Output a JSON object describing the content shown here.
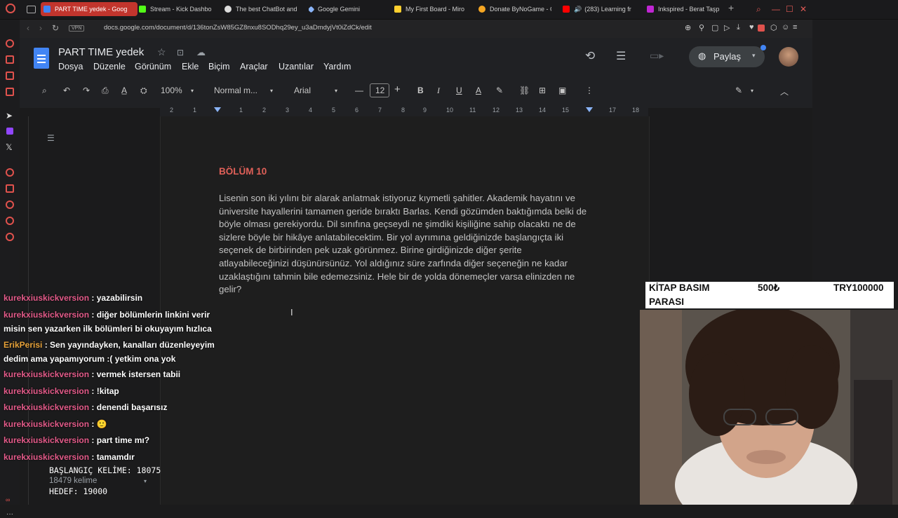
{
  "tabs": [
    {
      "label": "PART TIME yedek - Goog",
      "active": true
    },
    {
      "label": "Stream - Kick Dashbo"
    },
    {
      "label": "The best ChatBot and"
    },
    {
      "label": "Google Gemini"
    },
    {
      "label": "My First Board - Miro"
    },
    {
      "label": "Donate ByNoGame - C"
    },
    {
      "label": "(283) Learning fr"
    },
    {
      "label": "Inkspired - Berat Taşp"
    }
  ],
  "address": {
    "vpn": "VPN",
    "url": "docs.google.com/document/d/136tonZsW85GZ8nxu8SODhq29ey_u3aDmdyjVt0iZdCk/edit"
  },
  "docs": {
    "title": "PART TIME  yedek",
    "menu": [
      "Dosya",
      "Düzenle",
      "Görünüm",
      "Ekle",
      "Biçim",
      "Araçlar",
      "Uzantılar",
      "Yardım"
    ],
    "share_label": "Paylaş",
    "toolbar": {
      "zoom": "100%",
      "style": "Normal m...",
      "font": "Arial",
      "font_size": "12"
    },
    "ruler": [
      "2",
      "1",
      "1",
      "2",
      "3",
      "4",
      "5",
      "6",
      "7",
      "8",
      "9",
      "10",
      "11",
      "12",
      "13",
      "14",
      "15",
      "16",
      "17",
      "18"
    ]
  },
  "document": {
    "heading": "BÖLÜM 10",
    "paragraph": "Lisenin son iki yılını bir alarak anlatmak istiyoruz kıymetli şahitler. Akademik hayatını ve üniversite hayallerini tamamen geride bıraktı Barlas. Kendi gözümden baktığımda belki de böyle olması gerekiyordu. Dil sınıfına geçseydi ne şimdiki kişiliğine sahip olacaktı ne de sizlere böyle bir hikâye anlatabilecektim. Bir yol ayrımına geldiğinizde başlangıçta iki seçenek de birbirinden pek uzak görünmez. Birine girdiğinizde diğer şerite atlayabileceğinizi düşünürsünüz. Yol aldığınız süre zarfında diğer seçeneğin ne kadar uzaklaştığını tahmin bile edemezsiniz. Hele bir de yolda dönemeçler varsa elinizden ne gelir?"
  },
  "chat": [
    {
      "user": "kurekxiuskickversion",
      "msg": " : yazabilirsin"
    },
    {
      "user": "kurekxiuskickversion",
      "msg": " : diğer bölümlerin linkini verir misin sen yazarken ilk bölümleri bi okuyayım hızlıca"
    },
    {
      "user": "ErikPerisi",
      "msg": " : Sen yayındayken, kanalları düzenleyeyim dedim ama yapamıyorum :( yetkim ona yok"
    },
    {
      "user": "kurekxiuskickversion",
      "msg": " : vermek istersen tabii"
    },
    {
      "user": "kurekxiuskickversion",
      "msg": " : !kitap"
    },
    {
      "user": "kurekxiuskickversion",
      "msg": " : denendi başarısız"
    },
    {
      "user": "kurekxiuskickversion",
      "msg": " : 🙂"
    },
    {
      "user": "kurekxiuskickversion",
      "msg": " : part time mı?"
    },
    {
      "user": "kurekxiuskickversion",
      "msg": " : tamamdır"
    }
  ],
  "word_goal": {
    "start": "BAŞLANGIÇ KELİME: 18075",
    "count": "18479 kelime",
    "target": "HEDEF: 19000"
  },
  "donation_goal": {
    "label_line1": "KİTAP BASIM",
    "label_line2": "PARASI",
    "current": "500₺",
    "goal": "TRY100000"
  },
  "colors": {
    "accent": "#c2352d",
    "heading": "#e06058",
    "chat_user": "#e45b8a"
  }
}
